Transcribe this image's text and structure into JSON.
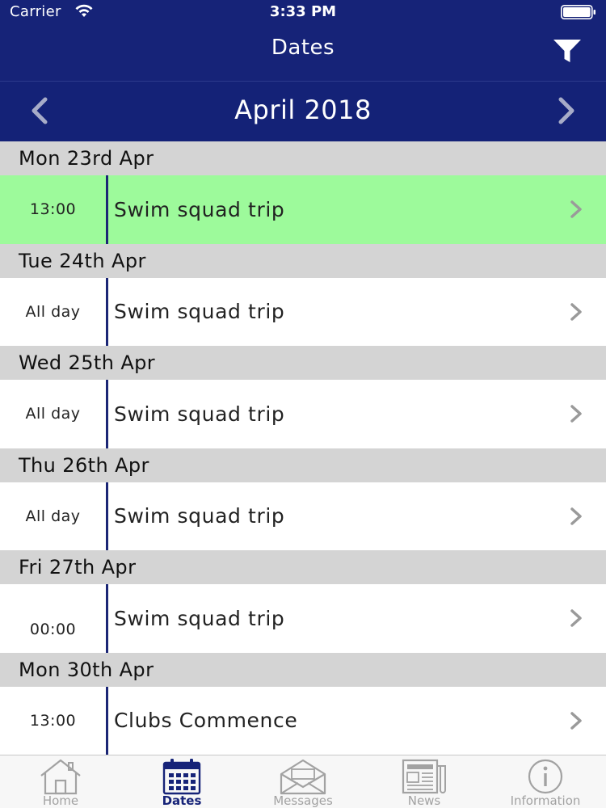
{
  "status_bar": {
    "carrier": "Carrier",
    "time": "3:33 PM"
  },
  "nav": {
    "title": "Dates",
    "filter_icon": "filter-icon"
  },
  "month_nav": {
    "label": "April 2018",
    "prev_icon": "chevron-left-icon",
    "next_icon": "chevron-right-icon"
  },
  "days": [
    {
      "date": "Mon 23rd Apr",
      "event": {
        "time": "13:00",
        "title": "Swim squad trip",
        "highlighted": true
      }
    },
    {
      "date": "Tue 24th Apr",
      "event": {
        "time": "All day",
        "title": "Swim squad trip",
        "highlighted": false
      }
    },
    {
      "date": "Wed 25th Apr",
      "event": {
        "time": "All day",
        "title": "Swim squad trip",
        "highlighted": false
      }
    },
    {
      "date": "Thu 26th Apr",
      "event": {
        "time": "All day",
        "title": "Swim squad trip",
        "highlighted": false
      }
    },
    {
      "date": "Fri 27th Apr",
      "event": {
        "time": "00:00",
        "title": "Swim squad trip",
        "highlighted": false
      }
    },
    {
      "date": "Mon 30th Apr",
      "event": {
        "time": "13:00",
        "title": "Clubs Commence",
        "highlighted": false
      }
    }
  ],
  "tabs": [
    {
      "label": "Home",
      "icon": "home-icon",
      "active": false
    },
    {
      "label": "Dates",
      "icon": "calendar-icon",
      "active": true
    },
    {
      "label": "Messages",
      "icon": "envelope-icon",
      "active": false
    },
    {
      "label": "News",
      "icon": "newspaper-icon",
      "active": false
    },
    {
      "label": "Information",
      "icon": "info-icon",
      "active": false
    }
  ],
  "colors": {
    "header": "#162378",
    "highlight_row": "#9dfa9b",
    "day_header": "#d4d4d4",
    "tab_active": "#162378",
    "tab_inactive": "#a2a2a2"
  }
}
